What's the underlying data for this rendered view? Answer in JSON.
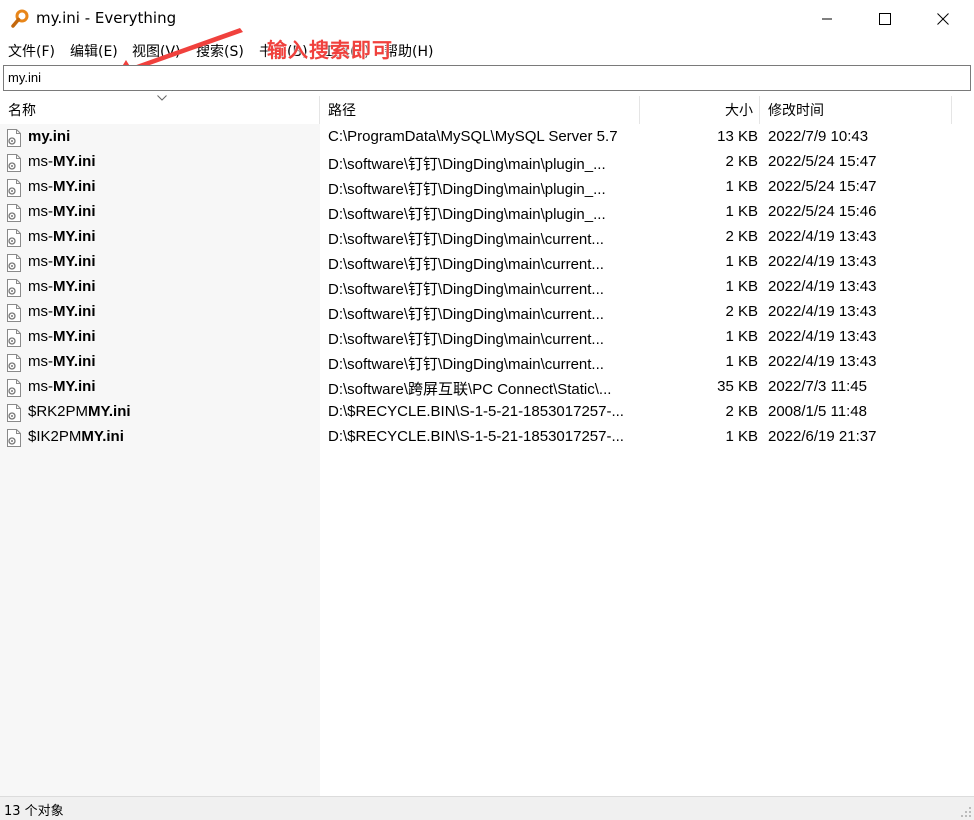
{
  "window": {
    "title": "my.ini - Everything",
    "icon": "magnifier-key-icon"
  },
  "menu": [
    {
      "label": "文件(F)"
    },
    {
      "label": "编辑(E)"
    },
    {
      "label": "视图(V)"
    },
    {
      "label": "搜索(S)"
    },
    {
      "label": "书签(B)"
    },
    {
      "label": "工具(T)"
    },
    {
      "label": "帮助(H)"
    }
  ],
  "annotation": {
    "text": "输入搜索即可",
    "color": "#f0413d"
  },
  "search": {
    "value": "my.ini"
  },
  "columns": {
    "name": "名称",
    "path": "路径",
    "size": "大小",
    "modified": "修改时间"
  },
  "rows": [
    {
      "name_pre": "",
      "name_bold": "my.ini",
      "path": "C:\\ProgramData\\MySQL\\MySQL Server 5.7",
      "size": "13 KB",
      "date": "2022/7/9 10:43"
    },
    {
      "name_pre": "ms-",
      "name_bold": "MY.ini",
      "path": "D:\\software\\钉钉\\DingDing\\main\\plugin_...",
      "size": "2 KB",
      "date": "2022/5/24 15:47"
    },
    {
      "name_pre": "ms-",
      "name_bold": "MY.ini",
      "path": "D:\\software\\钉钉\\DingDing\\main\\plugin_...",
      "size": "1 KB",
      "date": "2022/5/24 15:47"
    },
    {
      "name_pre": "ms-",
      "name_bold": "MY.ini",
      "path": "D:\\software\\钉钉\\DingDing\\main\\plugin_...",
      "size": "1 KB",
      "date": "2022/5/24 15:46"
    },
    {
      "name_pre": "ms-",
      "name_bold": "MY.ini",
      "path": "D:\\software\\钉钉\\DingDing\\main\\current...",
      "size": "2 KB",
      "date": "2022/4/19 13:43"
    },
    {
      "name_pre": "ms-",
      "name_bold": "MY.ini",
      "path": "D:\\software\\钉钉\\DingDing\\main\\current...",
      "size": "1 KB",
      "date": "2022/4/19 13:43"
    },
    {
      "name_pre": "ms-",
      "name_bold": "MY.ini",
      "path": "D:\\software\\钉钉\\DingDing\\main\\current...",
      "size": "1 KB",
      "date": "2022/4/19 13:43"
    },
    {
      "name_pre": "ms-",
      "name_bold": "MY.ini",
      "path": "D:\\software\\钉钉\\DingDing\\main\\current...",
      "size": "2 KB",
      "date": "2022/4/19 13:43"
    },
    {
      "name_pre": "ms-",
      "name_bold": "MY.ini",
      "path": "D:\\software\\钉钉\\DingDing\\main\\current...",
      "size": "1 KB",
      "date": "2022/4/19 13:43"
    },
    {
      "name_pre": "ms-",
      "name_bold": "MY.ini",
      "path": "D:\\software\\钉钉\\DingDing\\main\\current...",
      "size": "1 KB",
      "date": "2022/4/19 13:43"
    },
    {
      "name_pre": "ms-",
      "name_bold": "MY.ini",
      "path": "D:\\software\\跨屏互联\\PC Connect\\Static\\...",
      "size": "35 KB",
      "date": "2022/7/3 11:45"
    },
    {
      "name_pre": "$RK2PM",
      "name_bold": "MY.ini",
      "path": "D:\\$RECYCLE.BIN\\S-1-5-21-1853017257-...",
      "size": "2 KB",
      "date": "2008/1/5 11:48"
    },
    {
      "name_pre": "$IK2PM",
      "name_bold": "MY.ini",
      "path": "D:\\$RECYCLE.BIN\\S-1-5-21-1853017257-...",
      "size": "1 KB",
      "date": "2022/6/19 21:37"
    }
  ],
  "status": {
    "text": "13 个对象"
  }
}
